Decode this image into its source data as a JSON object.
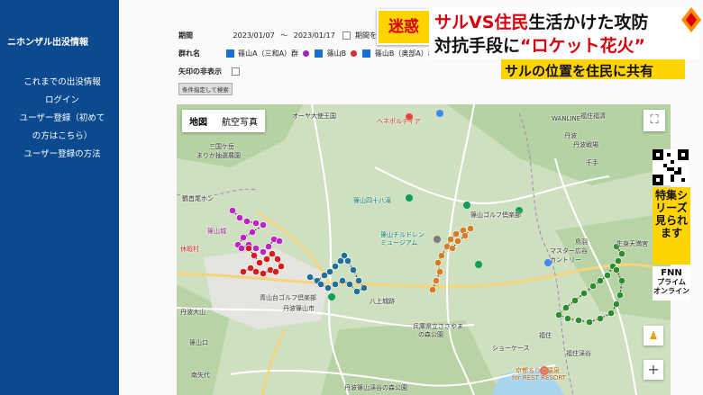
{
  "sidebar": {
    "title": "ニホンザル出没情報",
    "items": [
      "これまでの出没情報",
      "ログイン",
      "ユーザー登録（初めて",
      "の方はこちら）",
      "ユーザー登録の方法"
    ]
  },
  "form": {
    "period_label": "期間",
    "date_from": "2023/01/07",
    "date_sep": "〜",
    "date_to": "2023/01/17",
    "period_option": "期間を指定し",
    "group_label": "群れ名",
    "groups": [
      {
        "name": "篠山A（三和A）群",
        "color": "#9c27b0"
      },
      {
        "name": "篠山B",
        "color": "#d32f2f"
      },
      {
        "name": "篠山B（奥部A）群",
        "color": "#2e7d32"
      },
      {
        "name": "",
        "color": "#1565c0"
      },
      {
        "name": "",
        "color": "#00897b"
      }
    ],
    "arrow_label": "矢印の非表示",
    "search_button": "条件指定して検索"
  },
  "map": {
    "tab_map": "地図",
    "tab_satellite": "航空写真",
    "fullscreen_icon": "fullscreen-icon",
    "pegman_icon": "pegman-icon",
    "zoom_in": "+",
    "labels": [
      {
        "text": "オーヤ大使王国",
        "color": "default"
      },
      {
        "text": "ヘネポルティア",
        "color": "red"
      },
      {
        "text": "WANLINE",
        "color": "default"
      },
      {
        "text": "三国ケ岳",
        "color": "default"
      },
      {
        "text": "まりか抽選農園",
        "color": "default"
      },
      {
        "text": "鶴首尾ホン",
        "color": "default"
      },
      {
        "text": "篠山四十八滝",
        "color": "teal"
      },
      {
        "text": "篠山ゴルフ倶楽部",
        "color": "default"
      },
      {
        "text": "篠山チルドレン",
        "color": "teal"
      },
      {
        "text": "ミュージアム",
        "color": "teal"
      },
      {
        "text": "丹波篠山市",
        "color": "default"
      },
      {
        "text": "青山台ゴルフ倶楽部",
        "color": "default"
      },
      {
        "text": "八上城跡",
        "color": "default"
      },
      {
        "text": "兵庫県立ささやま",
        "color": "default"
      },
      {
        "text": "の森公園",
        "color": "default"
      },
      {
        "text": "丹波大山",
        "color": "default"
      },
      {
        "text": "篠山口",
        "color": "default"
      },
      {
        "text": "南矢代",
        "color": "default"
      },
      {
        "text": "丹波篠山渓谷の森公園",
        "color": "default"
      },
      {
        "text": "京都るり渓温泉",
        "color": "orange"
      },
      {
        "text": "for REST RESORT",
        "color": "orange"
      },
      {
        "text": "福住",
        "color": "default"
      },
      {
        "text": "ショーケース",
        "color": "default"
      },
      {
        "text": "福住渓谷",
        "color": "default"
      },
      {
        "text": "丹波",
        "color": "default"
      },
      {
        "text": "千手",
        "color": "default"
      },
      {
        "text": "鳥羽",
        "color": "default"
      },
      {
        "text": "カントリー",
        "color": "default"
      },
      {
        "text": "休暇村",
        "color": "red"
      },
      {
        "text": "篠山城",
        "color": "purple"
      },
      {
        "text": "福住福清",
        "color": "default"
      },
      {
        "text": "生身天満宮",
        "color": "default"
      },
      {
        "text": "マスター広谷",
        "color": "default"
      },
      {
        "text": "丹波戦場",
        "color": "default"
      }
    ]
  },
  "overlay": {
    "tag": "迷惑",
    "headline_1a": "サルVS住民",
    "headline_1b": "生活かけた攻防",
    "headline_2a": "対抗手段に",
    "headline_2b": "“ロケット花火”",
    "subtitle": "サルの位置を住民に共有",
    "special_series": "特集シリーズ",
    "special_watch": "見られます",
    "fnn_line1": "FNN",
    "fnn_line2": "プライム",
    "fnn_line3": "オンライン"
  },
  "colors": {
    "sidebar_bg": "#0c4a8f",
    "accent_yellow": "#ffd400",
    "accent_red": "#d8000c",
    "troop_purple": "#c11fc7",
    "troop_red": "#d81b1b",
    "troop_blue": "#1f6f9a",
    "troop_orange": "#d97a1e",
    "troop_green": "#2d8a2d"
  }
}
